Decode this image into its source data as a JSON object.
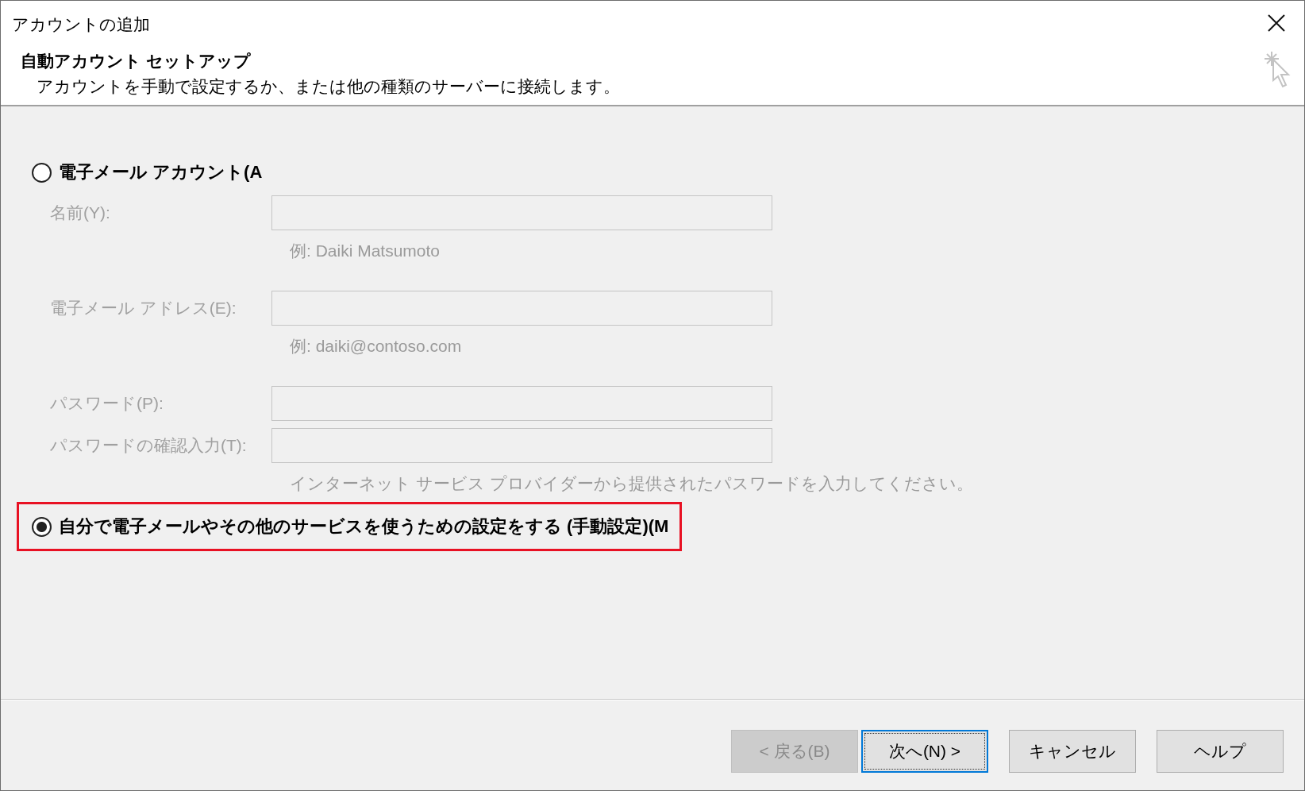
{
  "window": {
    "title": "アカウントの追加"
  },
  "header": {
    "title": "自動アカウント セットアップ",
    "subtitle": "アカウントを手動で設定するか、または他の種類のサーバーに接続します。"
  },
  "options": [
    {
      "kind": "form",
      "label": "電子メール アカウント(A",
      "selected": false,
      "highlighted": false,
      "fields": [
        {
          "label": "名前(Y):",
          "disabled": true,
          "hint": "例: Daiki Matsumoto"
        },
        {
          "label": "電子メール アドレス(E):",
          "disabled": true,
          "hint": "例: daiki@contoso.com"
        },
        {
          "label": "パスワード(P):",
          "disabled": true
        },
        {
          "label": "パスワードの確認入力(T):",
          "disabled": true,
          "hint": "インターネット サービス プロバイダーから提供されたパスワードを入力してください。"
        }
      ]
    },
    {
      "kind": "plain",
      "label": "自分で電子メールやその他のサービスを使うための設定をする (手動設定)(M",
      "selected": true,
      "highlighted": true
    }
  ],
  "buttons": [
    {
      "label": "< 戻る(B)",
      "disabled": true,
      "focused": false
    },
    {
      "label": "次へ(N) >",
      "disabled": false,
      "focused": true
    },
    {
      "label": "キャンセル",
      "disabled": false,
      "focused": false
    },
    {
      "label": "ヘルプ",
      "disabled": false,
      "focused": false
    }
  ]
}
